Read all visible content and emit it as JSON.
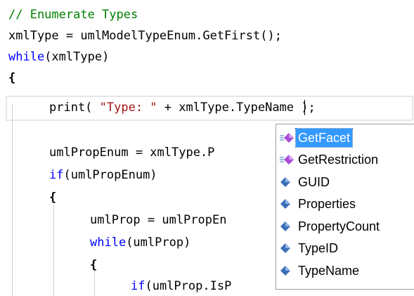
{
  "code": {
    "line1": "// Enumerate Types",
    "line2": "xmlType = umlModelTypeEnum.GetFirst();",
    "line3_kw": "while",
    "line3_rest": "(xmlType)",
    "line4": "{",
    "line5_a": "print( ",
    "line5_str": "\"Type: \"",
    "line5_b": " + xmlType.",
    "line5_c": "TypeName );",
    "line6": "umlPropEnum = xmlType.P",
    "line7_kw": "if",
    "line7_rest": "(umlPropEnum)",
    "line8": "{",
    "line9": "umlProp = umlPropEn",
    "line10_kw": "while",
    "line10_rest": "(umlProp)",
    "line11": "{",
    "line12_kw": "if",
    "line12_rest": "(umlProp.IsP"
  },
  "completion": {
    "selected_index": 0,
    "items": [
      {
        "label": "GetFacet",
        "kind": "method",
        "icon": "method-icon"
      },
      {
        "label": "GetRestriction",
        "kind": "method",
        "icon": "method-icon"
      },
      {
        "label": "GUID",
        "kind": "property",
        "icon": "property-icon"
      },
      {
        "label": "Properties",
        "kind": "property",
        "icon": "property-icon"
      },
      {
        "label": "PropertyCount",
        "kind": "property",
        "icon": "property-icon"
      },
      {
        "label": "TypeID",
        "kind": "property",
        "icon": "property-icon"
      },
      {
        "label": "TypeName",
        "kind": "property",
        "icon": "property-icon"
      }
    ]
  },
  "colors": {
    "keyword": "#0000ff",
    "comment": "#008000",
    "string": "#a31515",
    "selection": "#3399ff",
    "method_icon": "#a84ad6",
    "property_icon": "#3b6fb6"
  }
}
